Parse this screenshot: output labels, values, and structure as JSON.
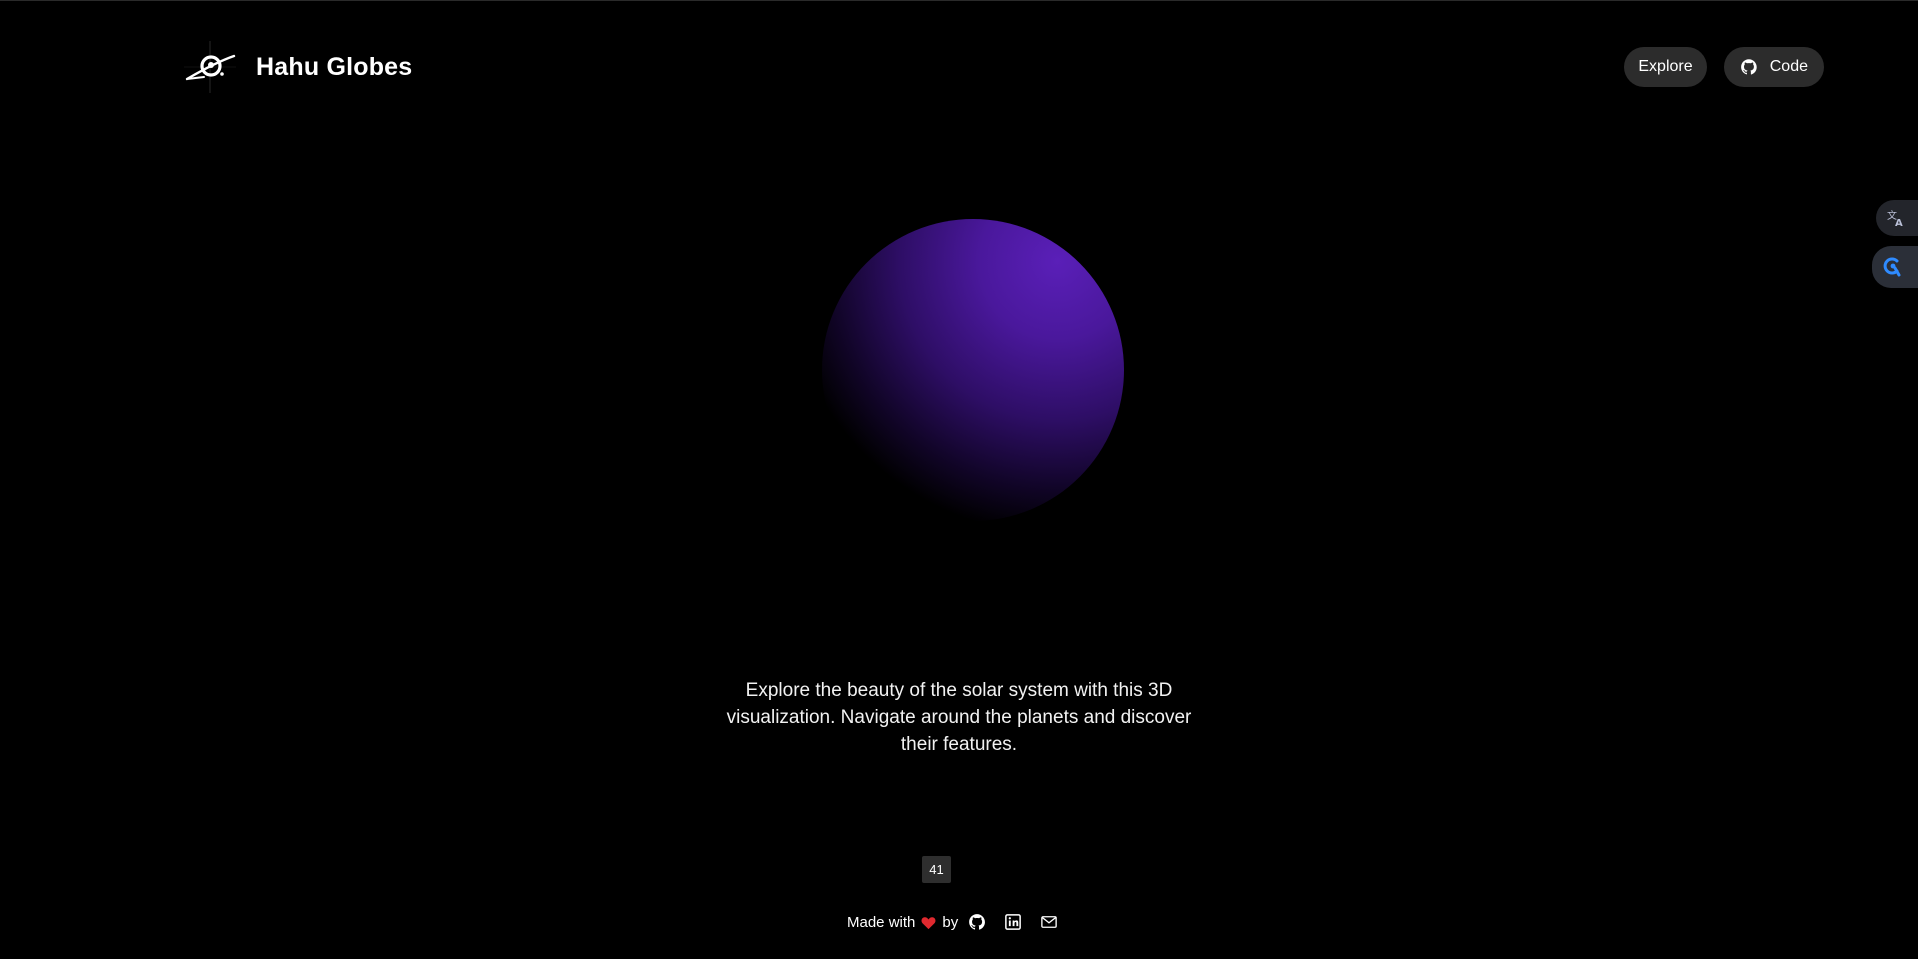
{
  "header": {
    "brand": "Hahu Globes",
    "logo_icon": "saturn-astronaut-icon",
    "nav": {
      "explore_label": "Explore",
      "code_label": "Code",
      "code_icon": "github-icon"
    }
  },
  "side_widgets": {
    "translate_icon": "translate-icon",
    "assistant_icon": "assistant-icon"
  },
  "hero": {
    "planet_color": "#5a1fb8",
    "description": "Explore the beauty of the solar system with this 3D visualization. Navigate around the planets and discover their features."
  },
  "counter": {
    "value": "41"
  },
  "footer": {
    "made_with": "Made with",
    "by": "by",
    "heart_icon": "heart-icon",
    "heart_color": "#e0292f",
    "links": [
      "github-icon",
      "linkedin-icon",
      "mail-icon"
    ]
  }
}
